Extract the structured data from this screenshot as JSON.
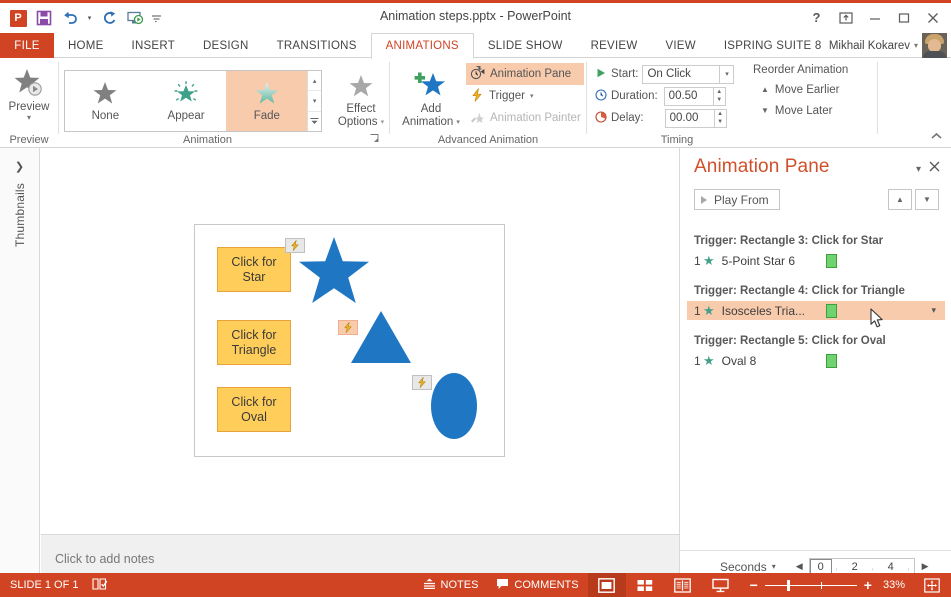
{
  "window": {
    "title": "Animation steps.pptx - PowerPoint",
    "help": "?",
    "ribbon_display": "ribbon-display-options",
    "minimize": "–",
    "restore": "□",
    "close": "✕"
  },
  "qat": {
    "app_logo": "P",
    "items": [
      {
        "name": "save-icon",
        "glyph": "save"
      },
      {
        "name": "undo-icon",
        "glyph": "undo"
      },
      {
        "name": "undo-dropdown",
        "glyph": "▾"
      },
      {
        "name": "redo-icon",
        "glyph": "redo"
      },
      {
        "name": "start-slideshow-icon",
        "glyph": "slideshow"
      },
      {
        "name": "customize-qat-icon",
        "glyph": "▾"
      }
    ]
  },
  "tabs": {
    "file": "FILE",
    "items": [
      {
        "label": "HOME",
        "active": false
      },
      {
        "label": "INSERT",
        "active": false
      },
      {
        "label": "DESIGN",
        "active": false
      },
      {
        "label": "TRANSITIONS",
        "active": false
      },
      {
        "label": "ANIMATIONS",
        "active": true
      },
      {
        "label": "SLIDE SHOW",
        "active": false
      },
      {
        "label": "REVIEW",
        "active": false
      },
      {
        "label": "VIEW",
        "active": false
      },
      {
        "label": "ISPRING SUITE 8",
        "active": false
      }
    ],
    "user_name": "Mikhail Kokarev",
    "user_caret": "▾"
  },
  "ribbon": {
    "preview": {
      "label": "Preview",
      "caret": "▾",
      "group_label": "Preview"
    },
    "animation": {
      "group_label": "Animation",
      "gallery": [
        {
          "name": "None",
          "selected": false
        },
        {
          "name": "Appear",
          "selected": false
        },
        {
          "name": "Fade",
          "selected": true
        }
      ],
      "scroll_up": "▴",
      "scroll_down": "▾",
      "scroll_more": "▾",
      "effect_options_line1": "Effect",
      "effect_options_line2": "Options",
      "effect_options_caret": "▾",
      "dialog_launcher": "⌐"
    },
    "advanced": {
      "group_label": "Advanced Animation",
      "add_animation_line1": "Add",
      "add_animation_line2": "Animation",
      "add_animation_caret": "▾",
      "animation_pane": "Animation Pane",
      "trigger": "Trigger",
      "trigger_caret": "▾",
      "animation_painter": "Animation Painter"
    },
    "timing": {
      "group_label": "Timing",
      "start_label": "Start:",
      "start_value": "On Click",
      "start_caret": "▾",
      "duration_label": "Duration:",
      "duration_value": "00.50",
      "delay_label": "Delay:",
      "delay_value": "00.00",
      "reorder_title": "Reorder Animation",
      "move_earlier": "Move Earlier",
      "move_later": "Move Later",
      "move_earlier_arrow": "▲",
      "move_later_arrow": "▼"
    },
    "collapse": "^"
  },
  "thumbnails": {
    "chevron": "❯",
    "label": "Thumbnails"
  },
  "slide": {
    "buttons": [
      {
        "line1": "Click for",
        "line2": "Star"
      },
      {
        "line1": "Click for",
        "line2": "Triangle"
      },
      {
        "line1": "Click for",
        "line2": "Oval"
      }
    ],
    "trigger_icon": "⚡",
    "shapes": [
      "star-shape",
      "triangle-shape",
      "oval-shape"
    ],
    "shape_color": "#1F77C4"
  },
  "notes": {
    "placeholder": "Click to add notes"
  },
  "animation_pane": {
    "title": "Animation Pane",
    "dropdown_caret": "▾",
    "close": "✕",
    "play_from": "Play From",
    "move_up": "▲",
    "move_down": "▼",
    "groups": [
      {
        "trigger": "Trigger: Rectangle 3: Click for Star",
        "rows": [
          {
            "num": "1",
            "name": "5-Point Star 6",
            "selected": false
          }
        ]
      },
      {
        "trigger": "Trigger: Rectangle 4: Click for Triangle",
        "rows": [
          {
            "num": "1",
            "name": "Isosceles Tria...",
            "selected": true,
            "caret": "▾"
          }
        ]
      },
      {
        "trigger": "Trigger: Rectangle 5: Click for Oval",
        "rows": [
          {
            "num": "1",
            "name": "Oval 8",
            "selected": false
          }
        ]
      }
    ],
    "footer": {
      "seconds_label": "Seconds",
      "seconds_caret": "▾",
      "prev_arrow": "◀",
      "next_arrow": "▶",
      "ticks": [
        "0",
        "2",
        "4"
      ]
    }
  },
  "statusbar": {
    "slide_count": "SLIDE 1 OF 1",
    "spellcheck_icon": "spellcheck-icon",
    "notes": "NOTES",
    "comments": "COMMENTS",
    "views": [
      "normal-view",
      "slide-sorter-view",
      "reading-view",
      "slideshow-view"
    ],
    "zoom_minus": "−",
    "zoom_plus": "+",
    "zoom_level": "33%",
    "fit_slide": "fit-to-window-icon"
  },
  "colors": {
    "accent": "#D04423",
    "selection": "#F8CBAD",
    "shape_blue": "#1F77C4",
    "button_yellow": "#FFCE5A",
    "green_bar": "#6FD36F",
    "green_star": "#45A08A"
  }
}
